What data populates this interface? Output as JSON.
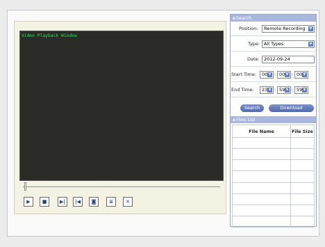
{
  "player": {
    "window_label": "Video Playback Window",
    "controls": [
      {
        "name": "play-icon",
        "glyph": "▶"
      },
      {
        "name": "stop-icon",
        "glyph": "■"
      },
      {
        "name": "pause-step-icon",
        "glyph": "▶|"
      },
      {
        "name": "step-back-icon",
        "glyph": "|◀"
      },
      {
        "name": "snapshot-icon",
        "glyph": "◙"
      },
      {
        "name": "download-icon",
        "glyph": "⇊"
      },
      {
        "name": "close-icon",
        "glyph": "✕"
      }
    ]
  },
  "search": {
    "header": "Search",
    "position_label": "Position:",
    "position_value": "Remote Recording",
    "type_label": "Type:",
    "type_value": "All Types",
    "date_label": "Date:",
    "date_value": "2012-09-24",
    "start_label": "Start Time:",
    "start_h": "00",
    "start_m": "00",
    "start_s": "00",
    "end_label": "End Time:",
    "end_h": "23",
    "end_m": "59",
    "end_s": "59",
    "search_button": "Search",
    "download_button": "Download"
  },
  "files": {
    "header": "Files List",
    "col_name": "File Name",
    "col_size": "File Size"
  }
}
